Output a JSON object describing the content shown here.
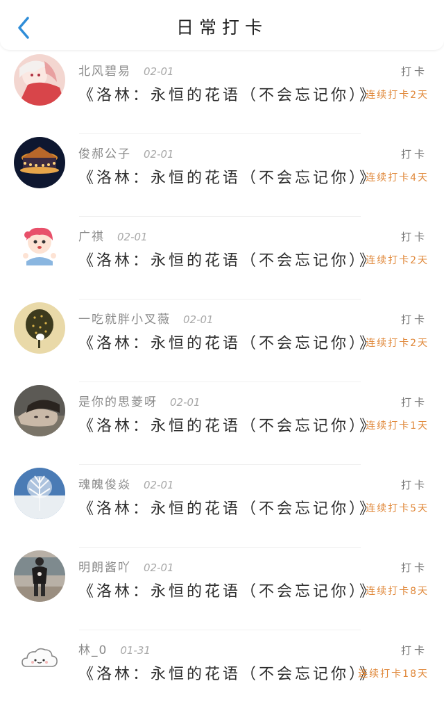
{
  "header": {
    "title": "日常打卡",
    "back_icon": "chevron-left-icon"
  },
  "colors": {
    "accent_back": "#2f8dd8",
    "streak": "#e0883a"
  },
  "items": [
    {
      "name": "北风碧易",
      "date": "02-01",
      "content": "《洛林：永恒的花语（不会忘记你）》",
      "action": "打卡",
      "streak": "连续打卡2天",
      "avatar": "anime-girl-avatar"
    },
    {
      "name": "俊郝公子",
      "date": "02-01",
      "content": "《洛林：永恒的花语（不会忘记你）》",
      "action": "打卡",
      "streak": "连续打卡4天",
      "avatar": "carousel-avatar"
    },
    {
      "name": "广祺",
      "date": "02-01",
      "content": "《洛林：永恒的花语（不会忘记你）》",
      "action": "打卡",
      "streak": "连续打卡2天",
      "avatar": "cartoon-girl-avatar"
    },
    {
      "name": "一吃就胖小叉薇",
      "date": "02-01",
      "content": "《洛林：永恒的花语（不会忘记你）》",
      "action": "打卡",
      "streak": "连续打卡2天",
      "avatar": "tree-avatar"
    },
    {
      "name": "是你的思菱呀",
      "date": "02-01",
      "content": "《洛林：永恒的花语（不会忘记你）》",
      "action": "打卡",
      "streak": "连续打卡1天",
      "avatar": "face-photo-avatar"
    },
    {
      "name": "魂魄俊焱",
      "date": "02-01",
      "content": "《洛林：永恒的花语（不会忘记你）》",
      "action": "打卡",
      "streak": "连续打卡5天",
      "avatar": "snow-tree-avatar"
    },
    {
      "name": "明朗酱吖",
      "date": "02-01",
      "content": "《洛林：永恒的花语（不会忘记你）》",
      "action": "打卡",
      "streak": "连续打卡8天",
      "avatar": "person-photo-avatar"
    },
    {
      "name": "林_0",
      "date": "01-31",
      "content": "《洛林：永恒的花语（不会忘记你）》",
      "action": "打卡",
      "streak": "连续打卡18天",
      "avatar": "cloud-avatar"
    }
  ]
}
